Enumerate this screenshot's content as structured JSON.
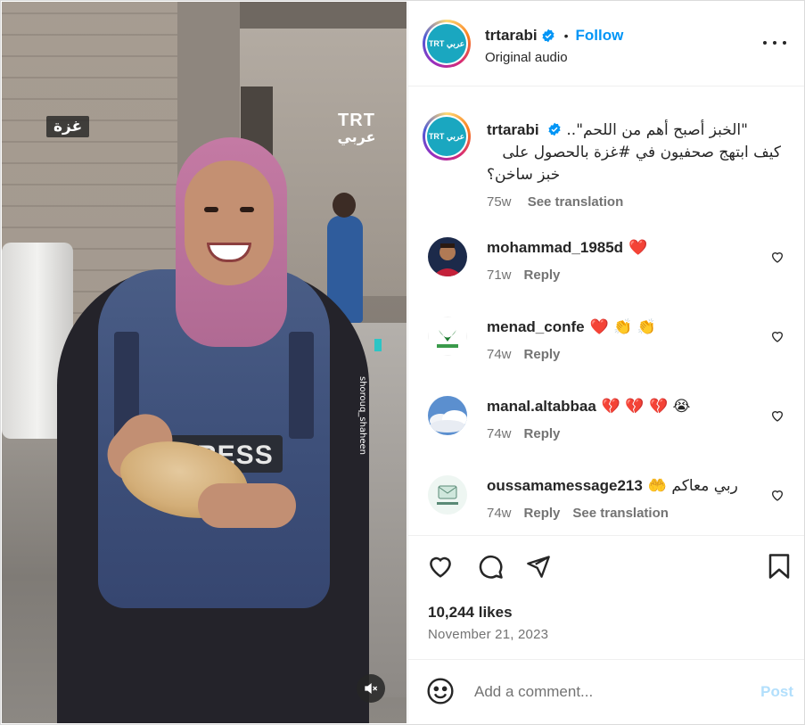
{
  "post": {
    "username": "trtarabi",
    "follow_label": "Follow",
    "dot": "•",
    "audio": "Original audio",
    "avatar_text": "TRT عربي"
  },
  "media": {
    "location_tag": "غزة",
    "logo_top": "TRT",
    "logo_bottom": "عربي",
    "credit": "shorouq_shaheen"
  },
  "caption": {
    "username": "trtarabi",
    "line1": "\"الخبز أصبح أهم من اللحم\"..",
    "line2": "كيف ابتهج صحفيون في #غزة بالحصول على",
    "line3": "خبز ساخن؟",
    "age": "75w",
    "see_translation": "See translation"
  },
  "comments": [
    {
      "username": "mohammad_1985d",
      "text": "❤️",
      "age": "71w",
      "reply": "Reply",
      "see_translation": ""
    },
    {
      "username": "menad_confe",
      "text": "❤️ 👏 👏",
      "age": "74w",
      "reply": "Reply",
      "see_translation": ""
    },
    {
      "username": "manal.altabbaa",
      "text": "💔 💔 💔 😭",
      "age": "74w",
      "reply": "Reply",
      "see_translation": ""
    },
    {
      "username": "oussamamessage213",
      "text": "🤲 ربي معاكم",
      "age": "74w",
      "reply": "Reply",
      "see_translation": "See translation"
    }
  ],
  "stats": {
    "likes": "10,244 likes",
    "date": "November 21, 2023"
  },
  "composer": {
    "placeholder": "Add a comment...",
    "post_label": "Post"
  },
  "icons": {
    "like": "heart-icon",
    "comment": "comment-icon",
    "share": "share-icon",
    "save": "bookmark-icon",
    "emoji": "emoji-icon",
    "more": "more-icon",
    "mute": "muted-audio-icon",
    "verified": "verified-badge-icon"
  },
  "colors": {
    "accent": "#0095f6",
    "text": "#262626",
    "secondary": "#737373",
    "post_disabled": "#b2dffc"
  }
}
